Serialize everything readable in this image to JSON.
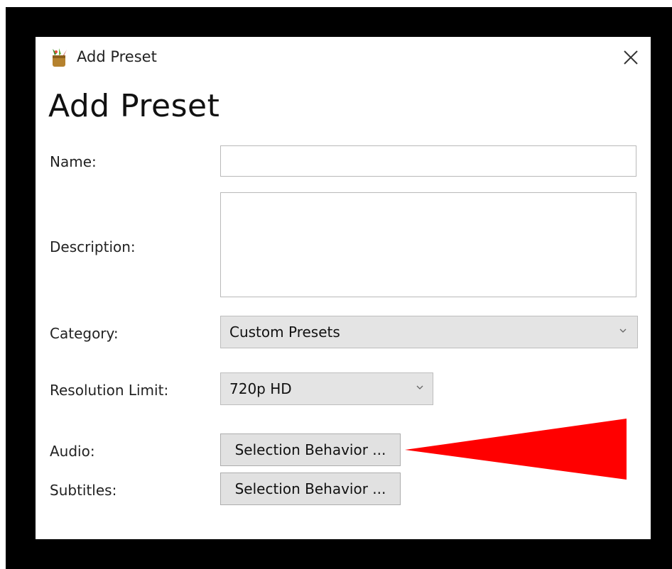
{
  "window": {
    "title": "Add Preset",
    "heading": "Add Preset",
    "close_icon": "close-icon",
    "app_icon": "app-logo-icon"
  },
  "form": {
    "name": {
      "label": "Name:",
      "value": ""
    },
    "description": {
      "label": "Description:",
      "value": ""
    },
    "category": {
      "label": "Category:",
      "selected": "Custom Presets"
    },
    "resolution_limit": {
      "label": "Resolution Limit:",
      "selected": "720p HD"
    },
    "audio": {
      "label": "Audio:",
      "button_label": "Selection Behavior ..."
    },
    "subtitles": {
      "label": "Subtitles:",
      "button_label": "Selection Behavior ..."
    }
  },
  "annotation": {
    "shape": "arrow pointing left at Audio button",
    "color": "#ff0000"
  },
  "colors": {
    "frame": "#000000",
    "window_bg": "#ffffff",
    "button_bg": "#e1e1e1",
    "arrow": "#ff0000"
  }
}
